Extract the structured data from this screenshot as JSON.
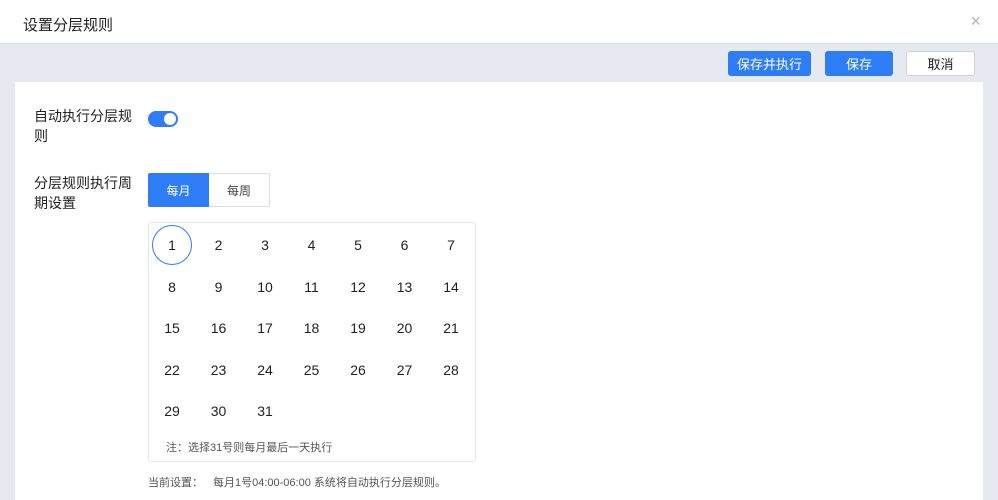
{
  "dialog": {
    "title": "设置分层规则",
    "close_icon": "×"
  },
  "toolbar": {
    "save_execute_label": "保存并执行",
    "save_label": "保存",
    "cancel_label": "取消"
  },
  "form": {
    "auto_execute_label": "自动执行分层规则",
    "auto_execute_enabled": true,
    "cycle_label": "分层规则执行周期设置",
    "cycle_options": [
      "每月",
      "每周"
    ],
    "cycle_selected": "每月",
    "days": [
      "1",
      "2",
      "3",
      "4",
      "5",
      "6",
      "7",
      "8",
      "9",
      "10",
      "11",
      "12",
      "13",
      "14",
      "15",
      "16",
      "17",
      "18",
      "19",
      "20",
      "21",
      "22",
      "23",
      "24",
      "25",
      "26",
      "27",
      "28",
      "29",
      "30",
      "31"
    ],
    "selected_day": "1",
    "calendar_note": "注：选择31号则每月最后一天执行",
    "current_label": "当前设置：",
    "current_value": "每月1号04:00-06:00 系统将自动执行分层规则。"
  },
  "colors": {
    "primary": "#2f7df6",
    "background": "#e6e9f0"
  }
}
